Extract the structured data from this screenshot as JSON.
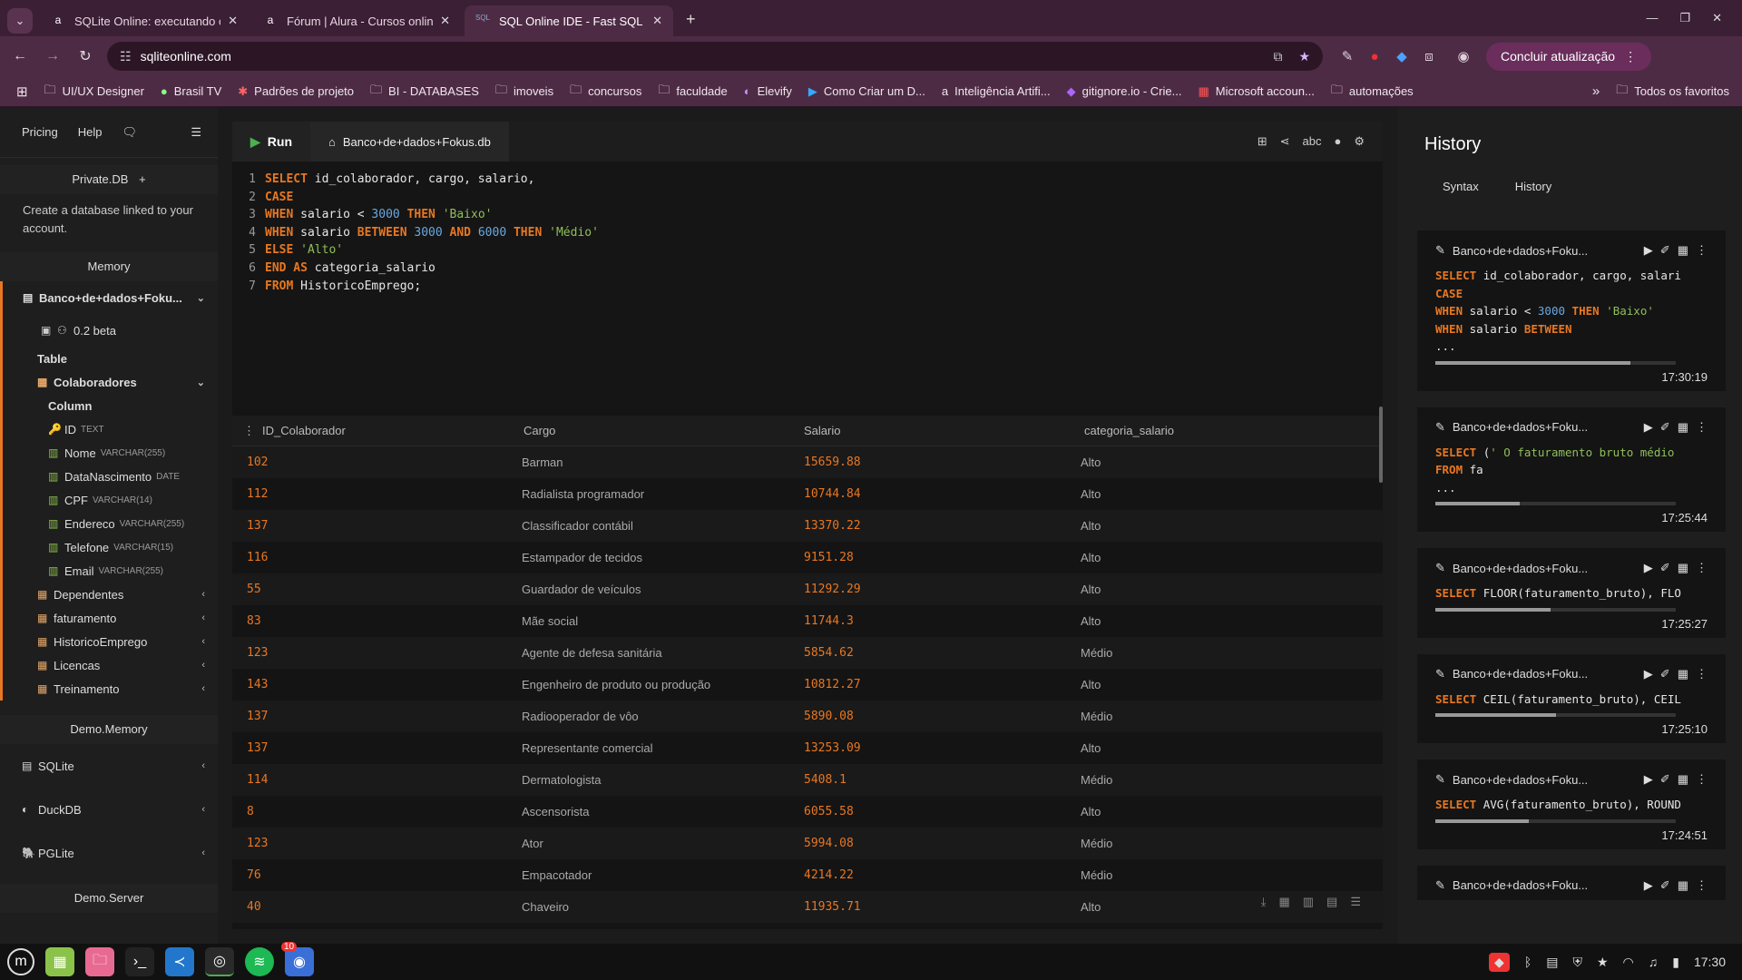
{
  "browser": {
    "tabs": [
      {
        "label": "SQLite Online: executando c",
        "icon": "alura-icon"
      },
      {
        "label": "Fórum | Alura - Cursos online",
        "icon": "alura-icon"
      },
      {
        "label": "SQL Online IDE - Fast SQL Ed",
        "icon": "sql-icon"
      }
    ],
    "url": "sqliteonline.com",
    "update_label": "Concluir atualização",
    "bookmarks": [
      "UI/UX Designer",
      "Brasil TV",
      "Padrões de projeto",
      "BI - DATABASES",
      "imoveis",
      "concursos",
      "faculdade",
      "Elevify",
      "Como Criar um D...",
      "Inteligência Artifi...",
      "gitignore.io - Crie...",
      "Microsoft accoun...",
      "automações"
    ],
    "all_bookmarks": "Todos os favoritos"
  },
  "sidebar": {
    "top": {
      "pricing": "Pricing",
      "help": "Help"
    },
    "private_db": "Private.DB",
    "private_text": "Create a database linked to your account.",
    "memory": "Memory",
    "db_name": "Banco+de+dados+Foku...",
    "version": "0.2 beta",
    "table_label": "Table",
    "table_name": "Colaboradores",
    "column_label": "Column",
    "columns": [
      {
        "name": "ID",
        "type": "TEXT"
      },
      {
        "name": "Nome",
        "type": "VARCHAR(255)"
      },
      {
        "name": "DataNascimento",
        "type": "DATE"
      },
      {
        "name": "CPF",
        "type": "VARCHAR(14)"
      },
      {
        "name": "Endereco",
        "type": "VARCHAR(255)"
      },
      {
        "name": "Telefone",
        "type": "VARCHAR(15)"
      },
      {
        "name": "Email",
        "type": "VARCHAR(255)"
      }
    ],
    "tables": [
      "Dependentes",
      "faturamento",
      "HistoricoEmprego",
      "Licencas",
      "Treinamento"
    ],
    "demo_memory": "Demo.Memory",
    "engines": [
      "SQLite",
      "DuckDB",
      "PGLite"
    ],
    "demo_server": "Demo.Server"
  },
  "editor": {
    "run_label": "Run",
    "db_tab": "Banco+de+dados+Fokus.db"
  },
  "results": {
    "headers": [
      "ID_Colaborador",
      "Cargo",
      "Salario",
      "categoria_salario"
    ],
    "rows": [
      [
        "102",
        "Barman",
        "15659.88",
        "Alto"
      ],
      [
        "112",
        "Radialista programador",
        "10744.84",
        "Alto"
      ],
      [
        "137",
        "Classificador contábil",
        "13370.22",
        "Alto"
      ],
      [
        "116",
        "Estampador de tecidos",
        "9151.28",
        "Alto"
      ],
      [
        "55",
        "Guardador de veículos",
        "11292.29",
        "Alto"
      ],
      [
        "83",
        "Mãe social",
        "11744.3",
        "Alto"
      ],
      [
        "123",
        "Agente de defesa sanitária",
        "5854.62",
        "Médio"
      ],
      [
        "143",
        "Engenheiro de produto ou produção",
        "10812.27",
        "Alto"
      ],
      [
        "137",
        "Radiooperador de vôo",
        "5890.08",
        "Médio"
      ],
      [
        "137",
        "Representante comercial",
        "13253.09",
        "Alto"
      ],
      [
        "114",
        "Dermatologista",
        "5408.1",
        "Médio"
      ],
      [
        "8",
        "Ascensorista",
        "6055.58",
        "Alto"
      ],
      [
        "123",
        "Ator",
        "5994.08",
        "Médio"
      ],
      [
        "76",
        "Empacotador",
        "4214.22",
        "Médio"
      ],
      [
        "40",
        "Chaveiro",
        "11935.71",
        "Alto"
      ]
    ]
  },
  "history": {
    "title": "History",
    "tabs": [
      "Syntax",
      "History"
    ],
    "items": [
      {
        "db": "Banco+de+dados+Foku...",
        "time": "17:30:19",
        "progress": 0.81
      },
      {
        "db": "Banco+de+dados+Foku...",
        "time": "17:25:44",
        "progress": 0.35
      },
      {
        "db": "Banco+de+dados+Foku...",
        "time": "17:25:27",
        "progress": 0.48
      },
      {
        "db": "Banco+de+dados+Foku...",
        "time": "17:25:10",
        "progress": 0.5
      },
      {
        "db": "Banco+de+dados+Foku...",
        "time": "17:24:51",
        "progress": 0.39
      },
      {
        "db": "Banco+de+dados+Foku...",
        "time": "",
        "progress": 0
      }
    ]
  },
  "taskbar": {
    "clock": "17:30",
    "badge": "10"
  }
}
